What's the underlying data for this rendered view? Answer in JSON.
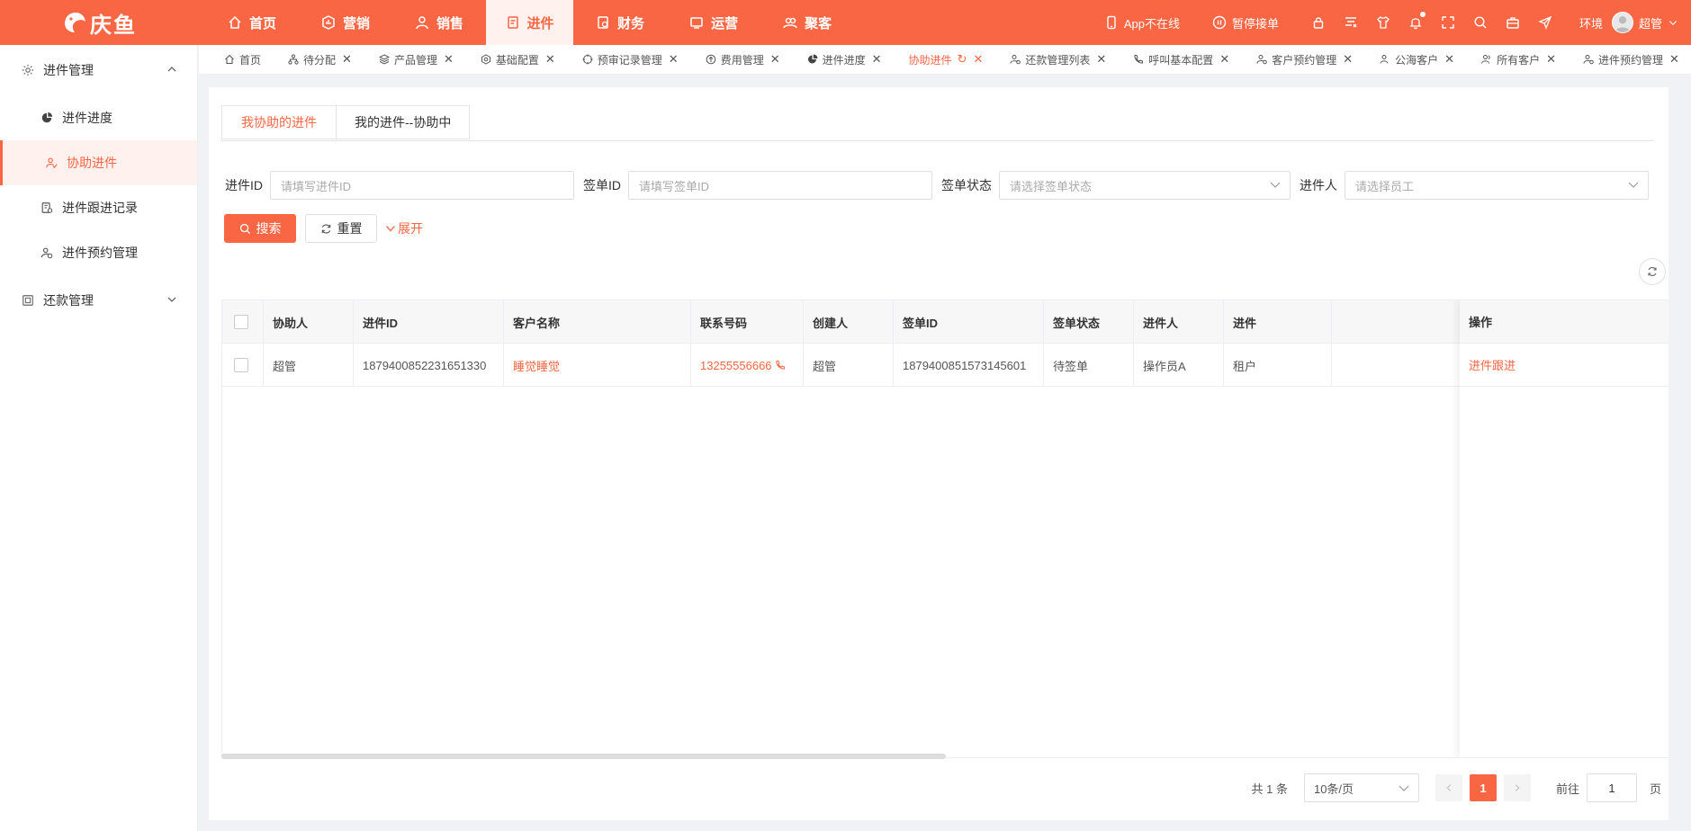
{
  "app": {
    "logo_text": "庆鱼",
    "brand_color": "#f96644"
  },
  "topnav": {
    "items": [
      {
        "label": "首页",
        "icon": "home-icon"
      },
      {
        "label": "营销",
        "icon": "marketing-icon"
      },
      {
        "label": "销售",
        "icon": "sales-icon"
      },
      {
        "label": "进件",
        "icon": "document-icon",
        "active": true
      },
      {
        "label": "财务",
        "icon": "finance-icon"
      },
      {
        "label": "运营",
        "icon": "operations-icon"
      },
      {
        "label": "聚客",
        "icon": "customers-icon"
      }
    ]
  },
  "topright": {
    "app_status": "App不在线",
    "pause_orders": "暂停接单",
    "env_label": "环境",
    "user_name": "超管"
  },
  "sidebar": {
    "groups": [
      {
        "label": "进件管理",
        "icon": "gear-icon",
        "expanded": true,
        "items": [
          {
            "label": "进件进度",
            "icon": "pie-chart-icon"
          },
          {
            "label": "协助进件",
            "icon": "handshake-icon",
            "active": true
          },
          {
            "label": "进件跟进记录",
            "icon": "record-icon"
          },
          {
            "label": "进件预约管理",
            "icon": "user-clock-icon"
          }
        ]
      },
      {
        "label": "还款管理",
        "icon": "repay-icon",
        "expanded": false,
        "items": []
      }
    ]
  },
  "tabs": [
    {
      "label": "首页",
      "closable": false
    },
    {
      "label": "待分配",
      "closable": true
    },
    {
      "label": "产品管理",
      "closable": true
    },
    {
      "label": "基础配置",
      "closable": true
    },
    {
      "label": "预审记录管理",
      "closable": true
    },
    {
      "label": "费用管理",
      "closable": true
    },
    {
      "label": "进件进度",
      "closable": true
    },
    {
      "label": "协助进件",
      "closable": true,
      "active": true
    },
    {
      "label": "还款管理列表",
      "closable": true
    },
    {
      "label": "呼叫基本配置",
      "closable": true
    },
    {
      "label": "客户预约管理",
      "closable": true
    },
    {
      "label": "公海客户",
      "closable": true
    },
    {
      "label": "所有客户",
      "closable": true
    },
    {
      "label": "进件预约管理",
      "closable": true
    }
  ],
  "subtabs": [
    "我协助的进件",
    "我的进件--协助中"
  ],
  "filters": {
    "jinjian_id_label": "进件ID",
    "jinjian_id_placeholder": "请填写进件ID",
    "qiandan_id_label": "签单ID",
    "qiandan_id_placeholder": "请填写签单ID",
    "status_label": "签单状态",
    "status_placeholder": "请选择签单状态",
    "person_label": "进件人",
    "person_placeholder": "请选择员工"
  },
  "buttons": {
    "search": "搜索",
    "reset": "重置",
    "expand": "展开"
  },
  "table": {
    "columns": [
      "协助人",
      "进件ID",
      "客户名称",
      "联系号码",
      "创建人",
      "签单ID",
      "签单状态",
      "进件人",
      "进件",
      "操作"
    ],
    "rows": [
      {
        "assistant": "超管",
        "jinjian_id": "1879400852231651330",
        "customer_name": "睡觉睡觉",
        "phone": "13255556666",
        "creator": "超管",
        "qiandan_id": "1879400851573145601",
        "status": "待签单",
        "submitter": "操作员A",
        "extra": "租户",
        "action": "进件跟进"
      }
    ]
  },
  "pagination": {
    "total": "共 1 条",
    "page_size": "10条/页",
    "current_page": "1",
    "goto_label": "前往",
    "goto_value": "1",
    "page_suffix": "页"
  }
}
